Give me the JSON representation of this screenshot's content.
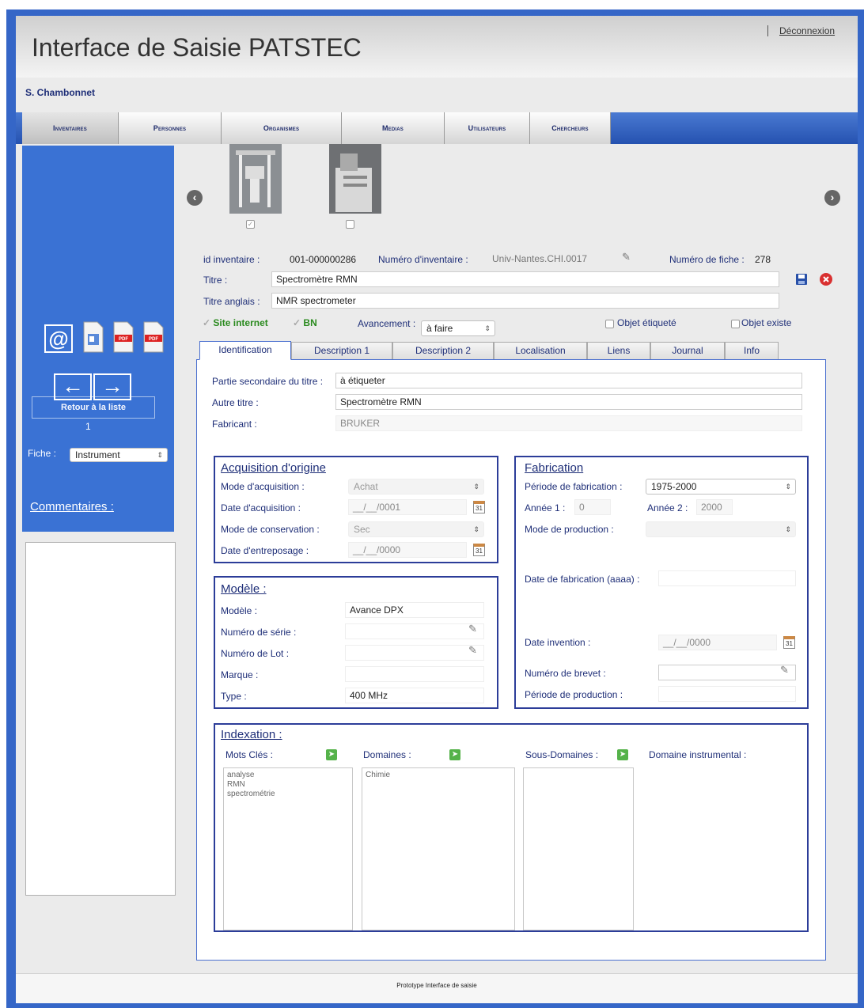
{
  "app": {
    "title": "Interface de Saisie PATSTEC",
    "logout": "Déconnexion",
    "user": "S. Chambonnet"
  },
  "nav": {
    "tabs": [
      "Inventaires",
      "Personnes",
      "Organismes",
      "Medias",
      "Utilisateurs",
      "Chercheurs"
    ]
  },
  "sidebar": {
    "back_label": "Retour à la liste",
    "page_number": "1",
    "fiche_label": "Fiche :",
    "fiche_value": "Instrument",
    "comments_label": "Commentaires :"
  },
  "record": {
    "id_label": "id inventaire :",
    "id_value": "001-000000286",
    "num_inv_label": "Numéro d'inventaire :",
    "num_inv_value": "Univ-Nantes.CHI.0017",
    "num_fiche_label": "Numéro de fiche :",
    "num_fiche_value": "278",
    "titre_label": "Titre :",
    "titre_value": "Spectromètre RMN",
    "titre_anglais_label": "Titre anglais :",
    "titre_anglais_value": "NMR spectrometer",
    "site_internet_label": "Site internet",
    "bn_label": "BN",
    "avancement_label": "Avancement :",
    "avancement_value": "à faire",
    "objet_etiquete_label": "Objet étiqueté",
    "objet_existe_label": "Objet existe"
  },
  "tabs": [
    "Identification",
    "Description 1",
    "Description 2",
    "Localisation",
    "Liens",
    "Journal",
    "Info"
  ],
  "identification": {
    "partie_label": "Partie secondaire du titre :",
    "partie_value": "à étiqueter",
    "autre_titre_label": "Autre titre :",
    "autre_titre_value": "Spectromètre RMN",
    "fabricant_label": "Fabricant :",
    "fabricant_value": "BRUKER"
  },
  "acquisition": {
    "title": "Acquisition d'origine",
    "mode_label": "Mode d'acquisition :",
    "mode_value": "Achat",
    "date_label": "Date d'acquisition :",
    "date_value": "__/__/0001",
    "conservation_label": "Mode de conservation :",
    "conservation_value": "Sec",
    "entreposage_label": "Date d'entreposage :",
    "entreposage_value": "__/__/0000"
  },
  "fabrication": {
    "title": "Fabrication",
    "periode_label": "Période de fabrication :",
    "periode_value": "1975-2000",
    "annee1_label": "Année 1 :",
    "annee1_value": "0",
    "annee2_label": "Année 2 :",
    "annee2_value": "2000",
    "mode_production_label": "Mode de production :",
    "date_fab_label": "Date de fabrication (aaaa) :",
    "date_invention_label": "Date invention :",
    "date_invention_value": "__/__/0000",
    "brevet_label": "Numéro de brevet :",
    "periode_production_label": "Période de production :"
  },
  "modele": {
    "title": "Modèle :",
    "modele_label": "Modèle :",
    "modele_value": "Avance DPX",
    "serie_label": "Numéro de série :",
    "lot_label": "Numéro de Lot :",
    "marque_label": "Marque :",
    "type_label": "Type :",
    "type_value": "400 MHz"
  },
  "indexation": {
    "title": "Indexation :",
    "mots_cles_label": "Mots Clés :",
    "mots_cles": [
      "analyse",
      "RMN",
      "spectrométrie"
    ],
    "domaines_label": "Domaines :",
    "domaines": [
      "Chimie"
    ],
    "sous_domaines_label": "Sous-Domaines :",
    "domaine_instr_label": "Domaine instrumental :"
  },
  "footer": {
    "text": "Prototype Interface de saisie"
  },
  "icons": {
    "calendar_day": "31",
    "pdf": "PDF"
  },
  "colors": {
    "frame_blue": "#3566c7",
    "label_navy": "#1f2f78",
    "box_border": "#2c3d99",
    "close_red": "#d93030",
    "add_green": "#55b24a"
  }
}
